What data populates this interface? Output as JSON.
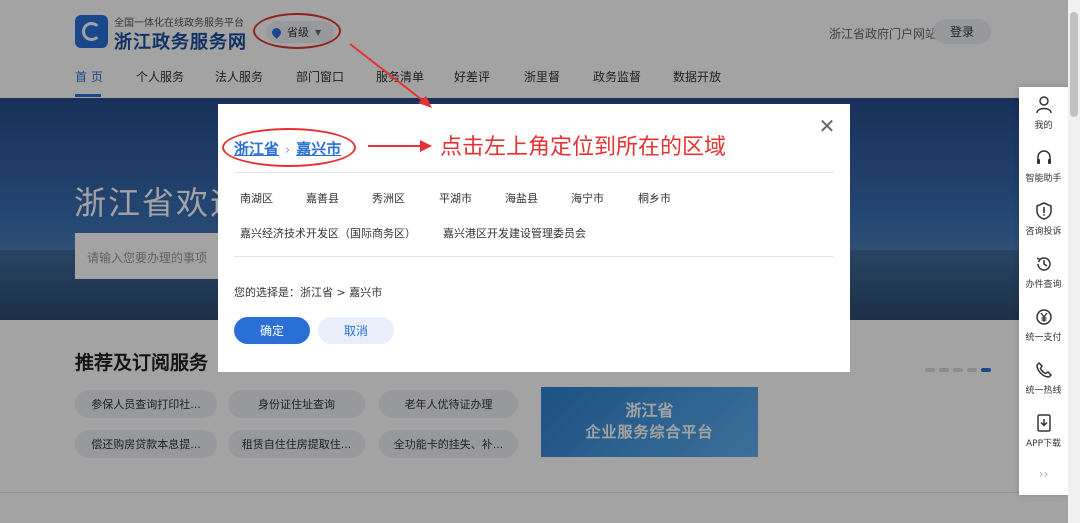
{
  "header": {
    "logo_subtitle": "全国一体化在线政务服务平台",
    "logo_title": "浙江政务服务网",
    "location_label": "省级",
    "portal_link": "浙江省政府门户网站",
    "login_label": "登录"
  },
  "nav": {
    "items": [
      {
        "label": "首 页",
        "active": true
      },
      {
        "label": "个人服务"
      },
      {
        "label": "法人服务"
      },
      {
        "label": "部门窗口"
      },
      {
        "label": "服务清单"
      },
      {
        "label": "好差评"
      },
      {
        "label": "浙里督"
      },
      {
        "label": "政务监督"
      },
      {
        "label": "数据开放"
      }
    ]
  },
  "banner": {
    "title": "浙江省欢迎您",
    "search_placeholder": "请输入您要办理的事项"
  },
  "recommend": {
    "title": "推荐及订阅服务",
    "chips": [
      "参保人员查询打印社...",
      "身份证住址查询",
      "老年人优待证办理",
      "偿还购房贷款本息提...",
      "租赁自住住房提取住...",
      "全功能卡的挂失、补..."
    ],
    "promo_line1": "浙江省",
    "promo_line2": "企业服务综合平台"
  },
  "sidebar": {
    "items": [
      {
        "label": "我的",
        "icon": "user-icon"
      },
      {
        "label": "智能助手",
        "icon": "headset-icon"
      },
      {
        "label": "咨询投诉",
        "icon": "alert-shield-icon"
      },
      {
        "label": "办件查询",
        "icon": "history-icon"
      },
      {
        "label": "统一支付",
        "icon": "yen-icon"
      },
      {
        "label": "统一热线",
        "icon": "phone-icon"
      },
      {
        "label": "APP下载",
        "icon": "download-icon"
      }
    ],
    "more": "››"
  },
  "modal": {
    "province": "浙江省",
    "separator": "›",
    "city": "嘉兴市",
    "annotation": "点击左上角定位到所在的区域",
    "districts_row1": [
      "南湖区",
      "嘉善县",
      "秀洲区",
      "平湖市",
      "海盐县",
      "海宁市",
      "桐乡市"
    ],
    "districts_row2": [
      "嘉兴经济技术开发区（国际商务区）",
      "嘉兴港区开发建设管理委员会"
    ],
    "selection_text": "您的选择是：浙江省 > 嘉兴市",
    "confirm_label": "确定",
    "cancel_label": "取消",
    "close_symbol": "✕"
  },
  "colors": {
    "brand_blue": "#2a6fd6",
    "annotation_red": "#e53333"
  }
}
